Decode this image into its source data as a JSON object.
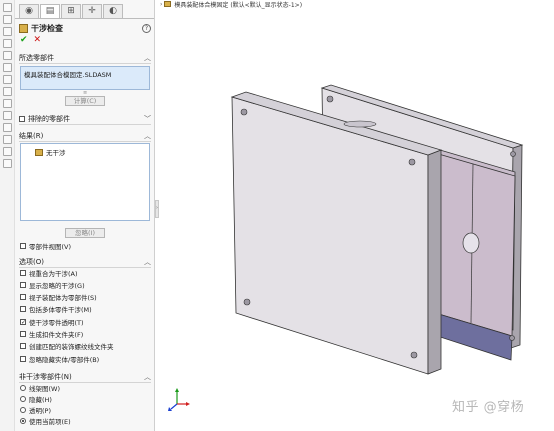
{
  "feature_manager": {
    "tabs": [
      {
        "icon": "feature-manager-icon"
      },
      {
        "icon": "property-manager-icon"
      },
      {
        "icon": "configuration-manager-icon"
      },
      {
        "icon": "dimxpert-icon"
      },
      {
        "icon": "display-manager-icon"
      }
    ],
    "title": "干涉检查",
    "help": "?",
    "ok": "✔",
    "cancel": "✕"
  },
  "selected_components": {
    "header": "所选零部件",
    "item": "模具装配体合模固定.SLDASM",
    "calculate_button": "计算(C)"
  },
  "excluded_components": {
    "header": "排除的零部件"
  },
  "results": {
    "header": "结果(R)",
    "item": "无干涉",
    "ignore_button": "忽略(I)",
    "component_view": "零部件视图(V)"
  },
  "options": {
    "header": "选项(O)",
    "items": [
      {
        "label": "视重合为干涉(A)",
        "checked": false
      },
      {
        "label": "显示忽略的干涉(G)",
        "checked": false
      },
      {
        "label": "视子装配体为零部件(S)",
        "checked": false
      },
      {
        "label": "包括多体零件干涉(M)",
        "checked": false
      },
      {
        "label": "使干涉零件透明(T)",
        "checked": true
      },
      {
        "label": "生成扣件文件夹(F)",
        "checked": false
      },
      {
        "label": "创建匹配的装饰螺纹线文件夹",
        "checked": false
      },
      {
        "label": "忽略隐藏实体/零部件(B)",
        "checked": false
      }
    ]
  },
  "non_interfering": {
    "header": "非干涉零部件(N)",
    "radios": [
      {
        "label": "线架图(W)",
        "selected": false
      },
      {
        "label": "隐藏(H)",
        "selected": false
      },
      {
        "label": "透明(P)",
        "selected": false
      },
      {
        "label": "使用当前项(E)",
        "selected": true
      }
    ]
  },
  "viewport": {
    "tree_label": "模具装配体合模固定  (默认<默认_显示状态-1>)",
    "watermark": "知乎 @穿杨",
    "colors": {
      "plate": "#e4e1e6",
      "plate_edge": "#a9a5ad",
      "block": "#c9bccb",
      "block_bottom": "#6e6f9e",
      "outline": "#333333"
    }
  }
}
